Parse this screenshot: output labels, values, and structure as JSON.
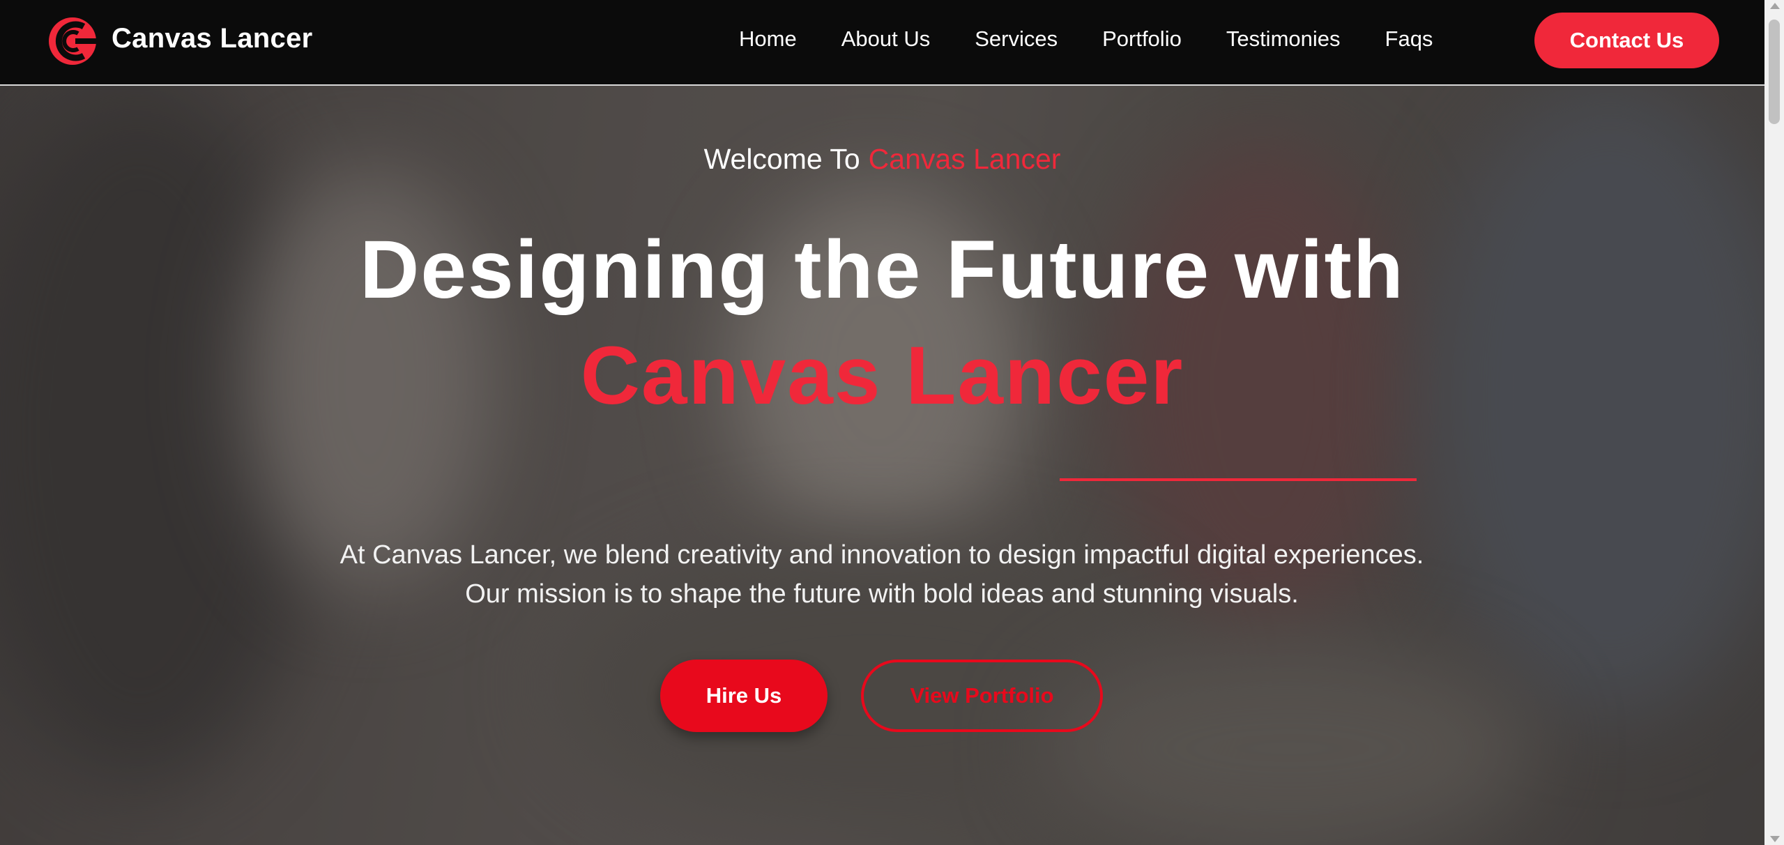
{
  "navbar": {
    "brand": "Canvas Lancer",
    "links": [
      "Home",
      "About Us",
      "Services",
      "Portfolio",
      "Testimonies",
      "Faqs"
    ],
    "contact_label": "Contact Us"
  },
  "hero": {
    "welcome_prefix": "Welcome To",
    "welcome_accent": "Canvas Lancer",
    "headline_line1": "Designing the Future with",
    "headline_line2": "Canvas Lancer",
    "description": "At Canvas Lancer, we blend creativity and innovation to design impactful digital experiences. Our mission is to shape the future with bold ideas and stunning visuals.",
    "primary_button": "Hire Us",
    "secondary_button": "View Portfolio"
  },
  "colors": {
    "accent": "#f0283a",
    "button_red": "#e8091c",
    "navbar_bg": "#0b0b0b"
  },
  "icons": {
    "logo": "canvas-lancer-logo-icon"
  }
}
